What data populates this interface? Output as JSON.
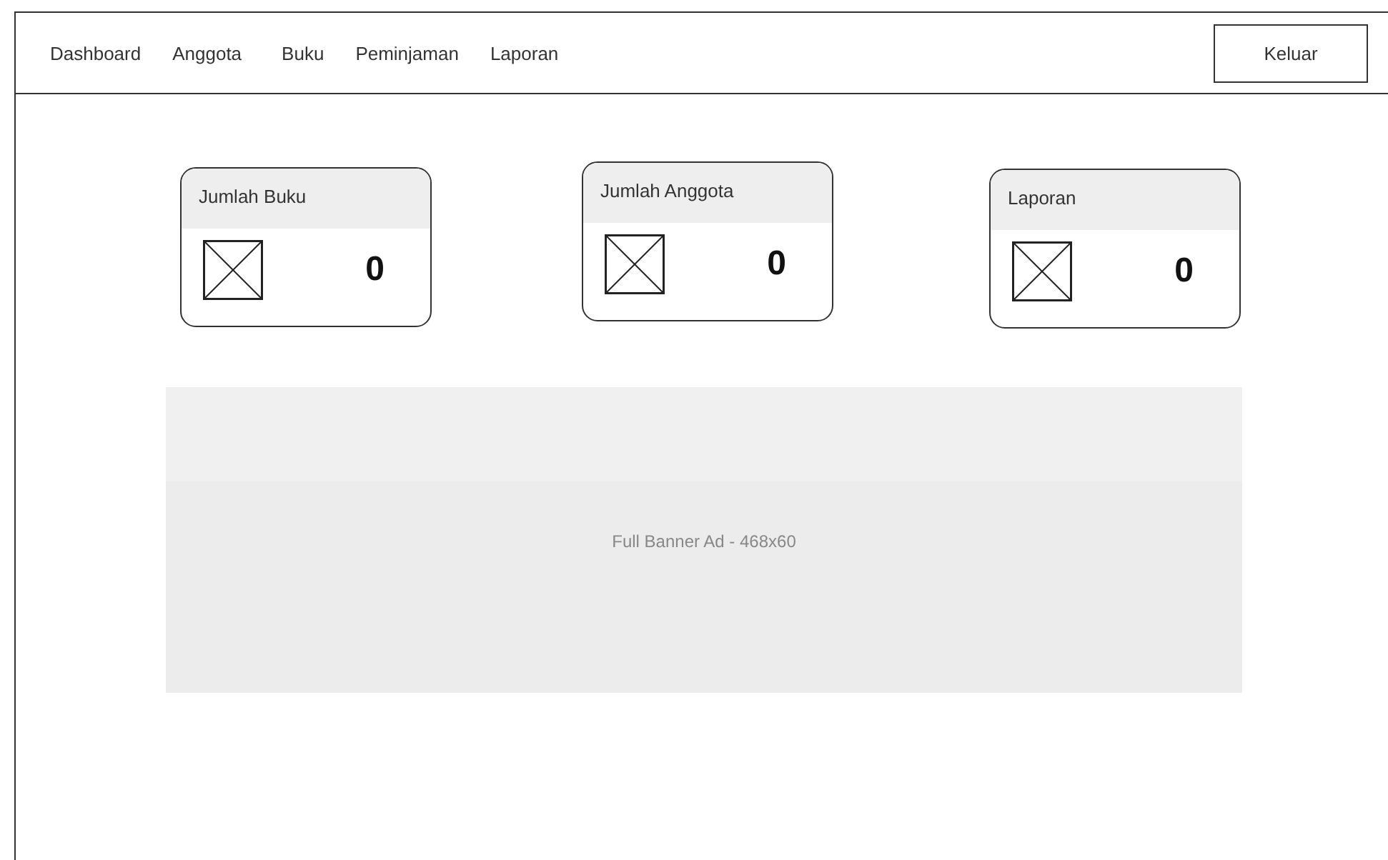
{
  "nav": {
    "items": [
      {
        "label": "Dashboard"
      },
      {
        "label": "Anggota"
      },
      {
        "label": "Buku"
      },
      {
        "label": "Peminjaman"
      },
      {
        "label": "Laporan"
      }
    ],
    "logout_button": "Keluar"
  },
  "cards": [
    {
      "title": "Jumlah Buku",
      "value": "0"
    },
    {
      "title": "Jumlah Anggota",
      "value": "0"
    },
    {
      "title": "Laporan",
      "value": "0"
    }
  ],
  "banner": {
    "label": "Full Banner Ad - 468x60"
  }
}
